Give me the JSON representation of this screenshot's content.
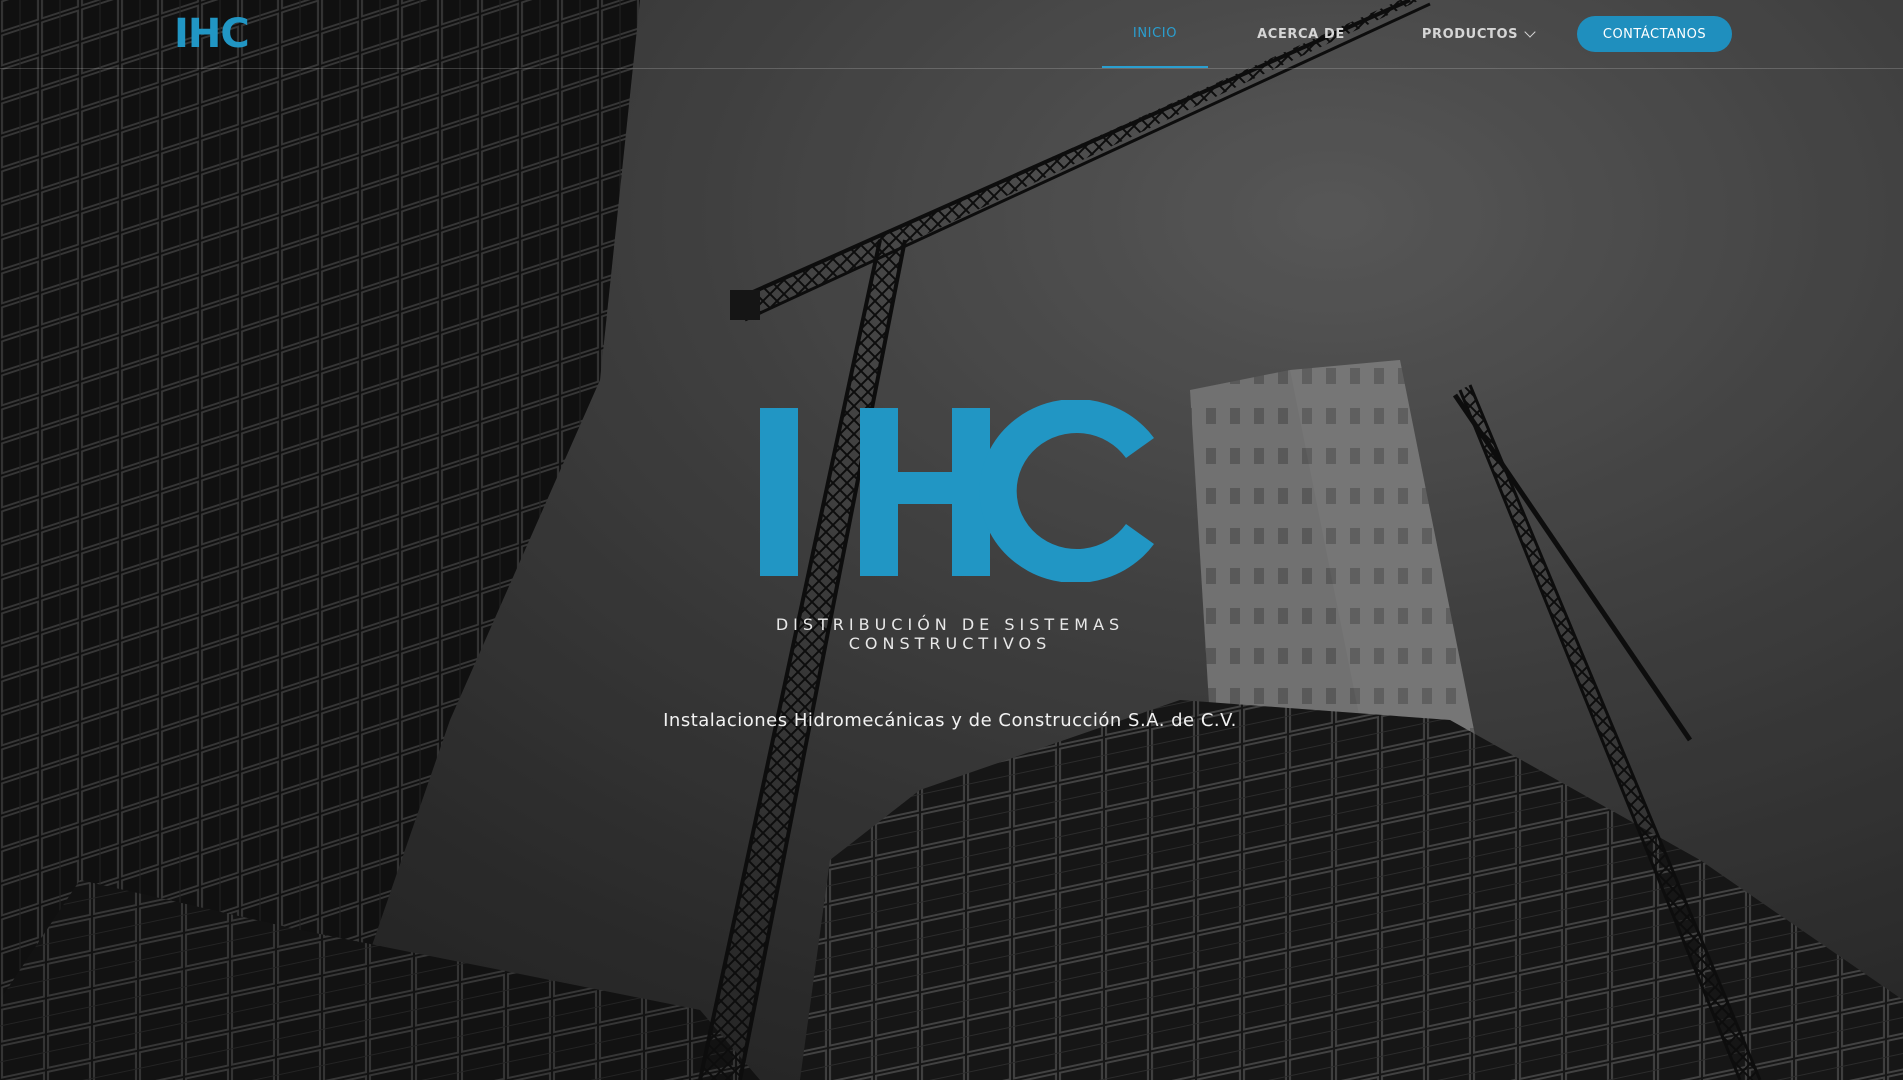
{
  "brand": {
    "logo_text": "IHC",
    "accent_color": "#2196c4"
  },
  "nav": {
    "items": [
      {
        "label": "INICIO",
        "active": true
      },
      {
        "label": "ACERCA DE",
        "active": false
      },
      {
        "label": "PRODUCTOS",
        "active": false,
        "has_dropdown": true
      }
    ],
    "cta_label": "CONTÁCTANOS"
  },
  "hero": {
    "logo_text": "IHC",
    "tagline_line1": "DISTRIBUCIÓN DE SISTEMAS",
    "tagline_line2": "CONSTRUCTIVOS",
    "company_name": "Instalaciones Hidromecánicas y de Construcción S.A. de C.V.",
    "background_image": "construction-site-cranes-photo"
  }
}
